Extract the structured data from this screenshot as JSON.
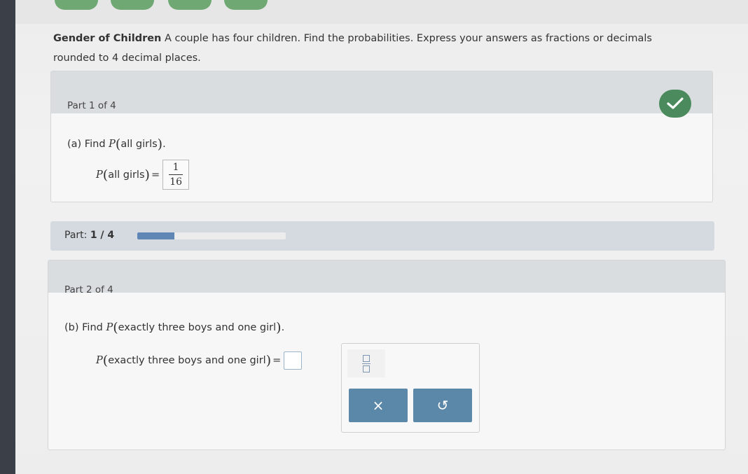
{
  "question": {
    "topic": "Gender of Children",
    "text_line1": " A couple has four children. Find the probabilities. Express your answers as fractions or decimals",
    "text_line2": "rounded to 4 decimal places."
  },
  "part1": {
    "title": "Part 1 of 4",
    "prompt_prefix": "(a) Find ",
    "event": "all girls",
    "answer": {
      "numerator": "1",
      "denominator": "16"
    }
  },
  "progress": {
    "label_prefix": "Part: ",
    "label_value": "1 / 4",
    "fraction_complete": 0.25
  },
  "part2": {
    "title": "Part 2 of 4",
    "prompt_prefix": "(b) Find ",
    "event": "exactly three boys and one girl"
  },
  "symbols": {
    "prob": "P",
    "open_paren": "(",
    "close_paren": ")",
    "period": ".",
    "equals": "=",
    "clear": "×",
    "undo": "↺"
  },
  "colors": {
    "check_badge": "#4a8a5c",
    "keypad_button": "#5b87a8",
    "progress_fill": "#5f86b5"
  }
}
